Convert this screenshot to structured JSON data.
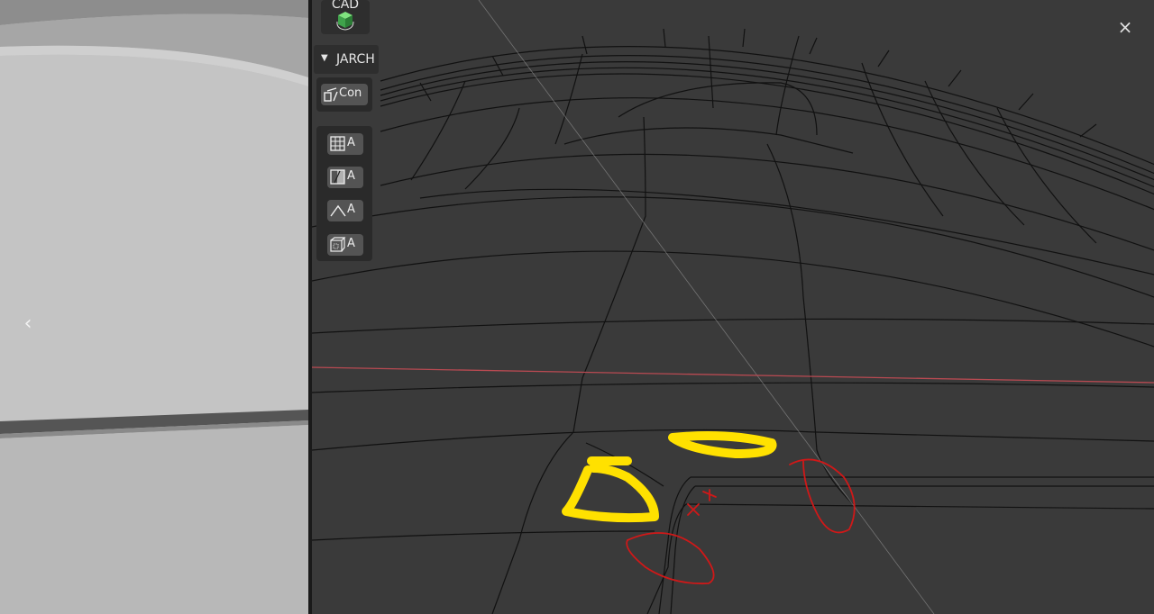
{
  "left_viewport": {
    "nav_prev_icon": "chevron-left-icon",
    "nav_prev_glyph": "‹"
  },
  "toolbar": {
    "logo_text": "CAD",
    "panel_header_label": "JARCH",
    "panel_collapse_glyph": "▼",
    "tool_con_label": "Con",
    "tool_buttons": [
      {
        "icon": "grid-icon",
        "label": "A"
      },
      {
        "icon": "half-square-icon",
        "label": "A"
      },
      {
        "icon": "angle-icon",
        "label": "A"
      },
      {
        "icon": "cube-icon",
        "label": "A"
      }
    ]
  },
  "window": {
    "close_glyph": "×"
  },
  "colors": {
    "viewport_bg": "#3a3a3a",
    "wire": "#111111",
    "x_axis": "#b94a52",
    "highlight_yellow": "#ffe100",
    "highlight_red": "#d01818"
  }
}
